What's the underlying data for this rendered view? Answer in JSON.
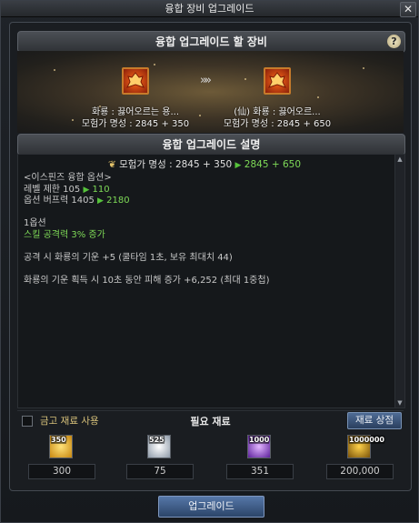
{
  "window": {
    "title": "융합 장비 업그레이드",
    "close_label": "✕"
  },
  "target_section": {
    "title": "융합 업그레이드 할 장비",
    "help_label": "?"
  },
  "items": {
    "arrow": "»»",
    "source": {
      "name": "화룡 : 끓어오르는 용...",
      "stat": "모험가 명성 : 2845 + 350",
      "icon": "fire-dragon-armor-icon"
    },
    "result": {
      "name": "(仙) 화룡 : 끓어오르...",
      "stat": "모험가 명성 : 2845 + 650",
      "icon": "fire-dragon-armor-icon"
    }
  },
  "description_section": {
    "title": "융합 업그레이드 설명",
    "stat_line": {
      "prefix": "모험가 명성 : 2845 + 350",
      "arrow": "▶",
      "result": "2845 + 650"
    },
    "lines": {
      "option_name": "<이스핀즈 융합 옵션>",
      "level_prefix": "레벨 제한 105",
      "level_arrow": "▶",
      "level_result": "110",
      "buff_prefix": "옵션 버프력 1405",
      "buff_arrow": "▶",
      "buff_result": "2180",
      "option1": "1옵션",
      "skill": "스킬 공격력 3% 증가",
      "effect1": "공격 시 화룡의 기운 +5 (쿨타임 1초, 보유 최대치 44)",
      "effect2": "화룡의 기운 획득 시 10초 동안 피해 증가 +6,252 (최대 1중첩)"
    }
  },
  "materials_bar": {
    "checkbox_label": "금고 재료 사용",
    "title": "필요 재료",
    "shop_button": "재료 상점"
  },
  "materials": [
    {
      "badge": "350",
      "quantity": "300",
      "icon": "gold-crystal-icon"
    },
    {
      "badge": "525",
      "quantity": "75",
      "icon": "white-orb-icon"
    },
    {
      "badge": "1000",
      "quantity": "351",
      "icon": "purple-orb-icon"
    },
    {
      "badge": "1000000",
      "quantity": "200,000",
      "icon": "gold-coins-icon"
    }
  ],
  "upgrade_button": "업그레이드",
  "colors": {
    "accent_blue": "#3c5a85",
    "highlight_green": "#7ed957",
    "item_orange": "#c77b2b"
  }
}
